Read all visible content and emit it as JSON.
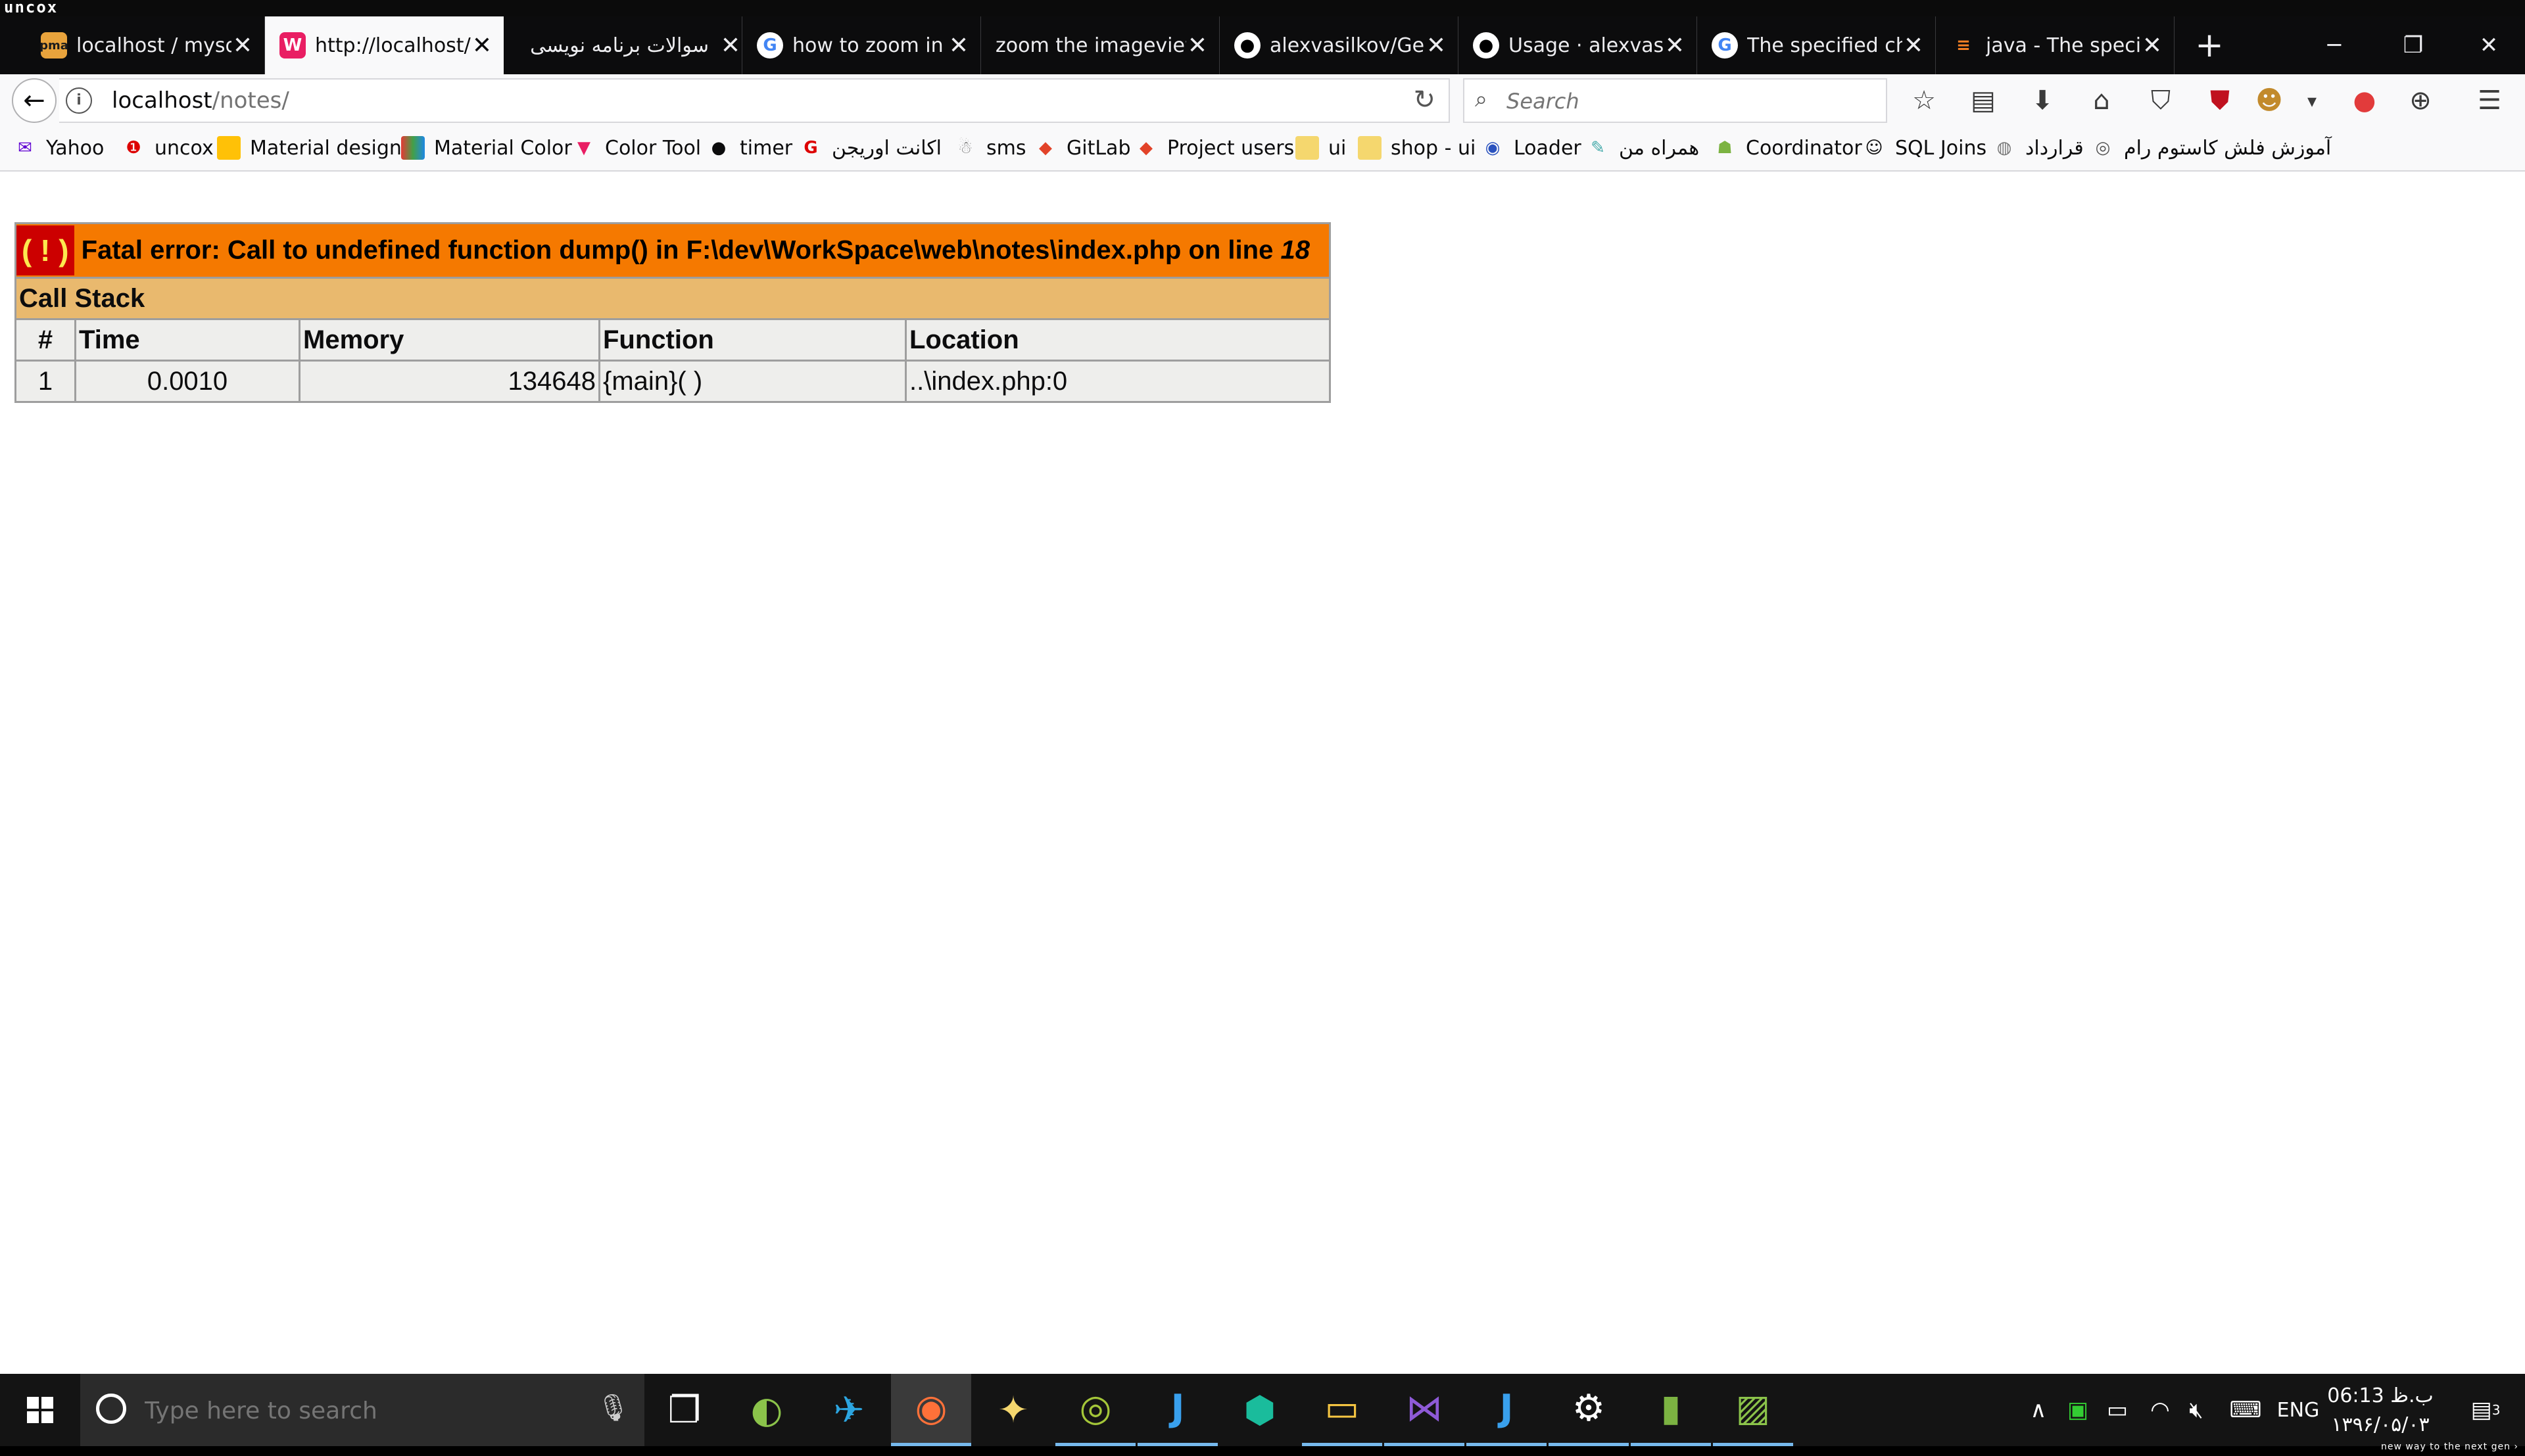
{
  "top_strip": {
    "label": "uncox"
  },
  "tabs": [
    {
      "title": "localhost / mysql",
      "icon": "phpmyadmin-icon",
      "active": false
    },
    {
      "title": "http://localhost/",
      "icon": "site-icon",
      "active": true
    },
    {
      "title": "سوالات برنامه نویسی",
      "icon": "",
      "active": false
    },
    {
      "title": "how to zoom in",
      "icon": "google-icon",
      "active": false
    },
    {
      "title": "zoom the imageview",
      "icon": "",
      "active": false
    },
    {
      "title": "alexvasilkov/GestureViews",
      "icon": "github-icon",
      "active": false
    },
    {
      "title": "Usage · alexvasilkov",
      "icon": "github-icon",
      "active": false
    },
    {
      "title": "The specified child",
      "icon": "google-icon",
      "active": false
    },
    {
      "title": "java - The specified",
      "icon": "stackoverflow-icon",
      "active": false
    }
  ],
  "navbar": {
    "url_host": "localhost",
    "url_path": "/notes/",
    "search_placeholder": "Search"
  },
  "bookmarks": [
    {
      "label": "Yahoo",
      "icon": "mail-icon"
    },
    {
      "label": "uncox",
      "icon": "alert-icon"
    },
    {
      "label": "Material design",
      "icon": "material-icon"
    },
    {
      "label": "Material Color",
      "icon": "palette-icon"
    },
    {
      "label": "Color Tool",
      "icon": "colortool-icon"
    },
    {
      "label": "timer",
      "icon": "github-icon"
    },
    {
      "label": "اکانت اوریجن",
      "icon": "g-icon"
    },
    {
      "label": "sms",
      "icon": "ghost-icon"
    },
    {
      "label": "GitLab",
      "icon": "gitlab-icon"
    },
    {
      "label": "Project users",
      "icon": "gitlab-icon"
    },
    {
      "label": "ui",
      "icon": "folder-icon"
    },
    {
      "label": "shop - ui",
      "icon": "folder-icon"
    },
    {
      "label": "Loader",
      "icon": "loader-icon"
    },
    {
      "label": "همراه من",
      "icon": "bird-icon"
    },
    {
      "label": "Coordinator",
      "icon": "android-icon"
    },
    {
      "label": "SQL Joins",
      "icon": "person-icon"
    },
    {
      "label": "قرارداد",
      "icon": "globe-icon"
    },
    {
      "label": "آموزش فلش کاستوم رام",
      "icon": "disc-icon"
    }
  ],
  "error": {
    "bang": "( ! )",
    "message": "Fatal error: Call to undefined function dump() in F:\\dev\\WorkSpace\\web\\notes\\index.php on line ",
    "line": "18",
    "call_stack_title": "Call Stack",
    "headers": [
      "#",
      "Time",
      "Memory",
      "Function",
      "Location"
    ],
    "rows": [
      {
        "num": "1",
        "time": "0.0010",
        "memory": "134648",
        "function": "{main}( )",
        "location": "..\\index.php:0"
      }
    ]
  },
  "taskbar": {
    "search_placeholder": "Type here to search",
    "language": "ENG",
    "time": "06:13 ب.ظ",
    "date": "۱۳۹۶/۰۵/۰۳",
    "notifications": "3"
  },
  "bottom_strip": {
    "label": "new way to the next gen ›"
  },
  "colors": {
    "error_orange": "#f57900",
    "error_red": "#cc0000",
    "stack_title": "#e9b96e",
    "stack_cell": "#eeeeec"
  }
}
